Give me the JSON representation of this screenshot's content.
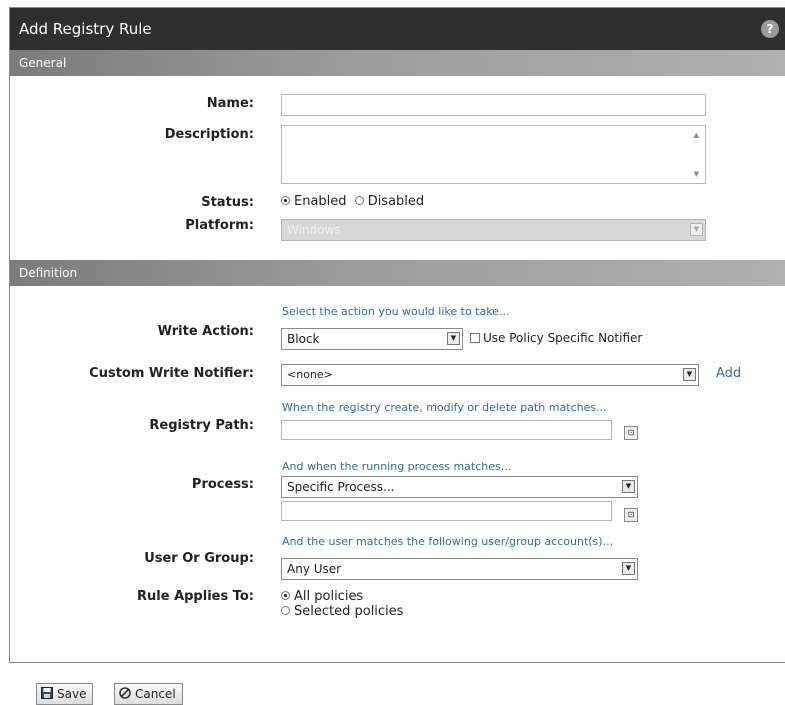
{
  "dialog": {
    "title": "Add Registry Rule",
    "help": "?"
  },
  "sections": {
    "general": "General",
    "definition": "Definition"
  },
  "general": {
    "name_label": "Name:",
    "name_value": "",
    "description_label": "Description:",
    "description_value": "",
    "status_label": "Status:",
    "status_options": [
      "Enabled",
      "Disabled"
    ],
    "status_selected": "Enabled",
    "platform_label": "Platform:",
    "platform_value": "Windows"
  },
  "definition": {
    "write_action_hint": "Select the action you would like to take...",
    "write_action_label": "Write Action:",
    "write_action_value": "Block",
    "policy_notifier_label": "Use Policy Specific Notifier",
    "policy_notifier_checked": false,
    "custom_notifier_label": "Custom Write Notifier:",
    "custom_notifier_value": "<none>",
    "add_link": "Add",
    "registry_hint": "When the registry create, modify or delete path matches...",
    "registry_label": "Registry Path:",
    "registry_value": "",
    "process_hint": "And when the running process matches...",
    "process_label": "Process:",
    "process_value": "Specific Process...",
    "process_path_value": "",
    "user_hint": "And the user matches the following user/group account(s)...",
    "user_label": "User Or Group:",
    "user_value": "Any User",
    "applies_label": "Rule Applies To:",
    "applies_options": [
      "All policies",
      "Selected policies"
    ],
    "applies_selected": "All policies"
  },
  "footer": {
    "save": "Save",
    "cancel": "Cancel"
  },
  "icons": {
    "help": "help-icon",
    "save": "floppy-disk-icon",
    "cancel": "cancel-circle-icon",
    "dropdown": "chevron-down-icon",
    "browse": "browse-icon"
  }
}
